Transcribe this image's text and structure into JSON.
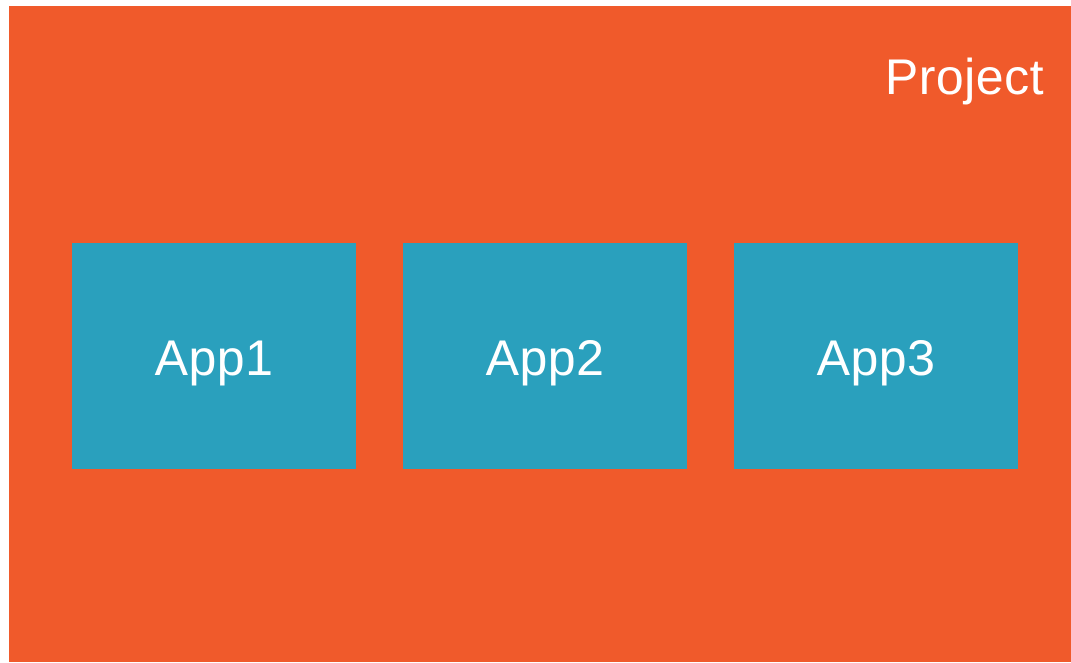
{
  "colors": {
    "project_background": "#f05a2b",
    "app_background": "#2aa0bd",
    "text": "#ffffff"
  },
  "project": {
    "title": "Project"
  },
  "apps": [
    {
      "label": "App1"
    },
    {
      "label": "App2"
    },
    {
      "label": "App3"
    }
  ]
}
